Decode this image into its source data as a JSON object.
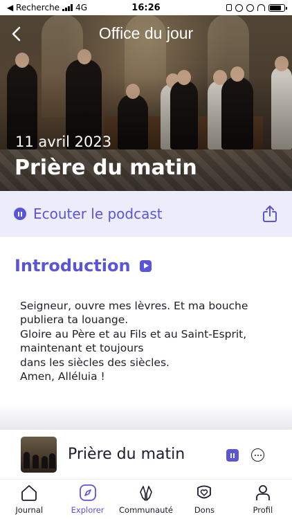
{
  "status_bar": {
    "carrier": "◀ Recherche",
    "network": "4G",
    "time": "16:26"
  },
  "header": {
    "title": "Office du jour",
    "back_icon": "chevron-left-icon"
  },
  "hero": {
    "date": "11 avril 2023",
    "heading": "Prière du matin"
  },
  "podcast": {
    "label": "Ecouter le podcast",
    "icon": "pause-icon",
    "share_icon": "share-icon"
  },
  "section": {
    "title": "Introduction",
    "play_icon": "play-icon",
    "lines": [
      "Seigneur, ouvre mes lèvres. Et ma bouche",
      "publiera ta louange.",
      "Gloire au Père et au Fils et au Saint-Esprit,",
      "maintenant et toujours",
      "dans les siècles des siècles.",
      "Amen,  Alléluia !"
    ]
  },
  "mini_player": {
    "title": "Prière du matin",
    "pause_icon": "pause-icon",
    "more_icon": "more-icon"
  },
  "tabs": [
    {
      "label": "Journal",
      "icon": "home-icon",
      "active": false
    },
    {
      "label": "Explorer",
      "icon": "compass-icon",
      "active": true
    },
    {
      "label": "Communauté",
      "icon": "praying-hands-icon",
      "active": false
    },
    {
      "label": "Dons",
      "icon": "heart-icon",
      "active": false
    },
    {
      "label": "Profil",
      "icon": "user-icon",
      "active": false
    }
  ],
  "colors": {
    "accent": "#5a55d8",
    "podcast_bg": "#ececfb",
    "text": "#1c1c2e"
  }
}
